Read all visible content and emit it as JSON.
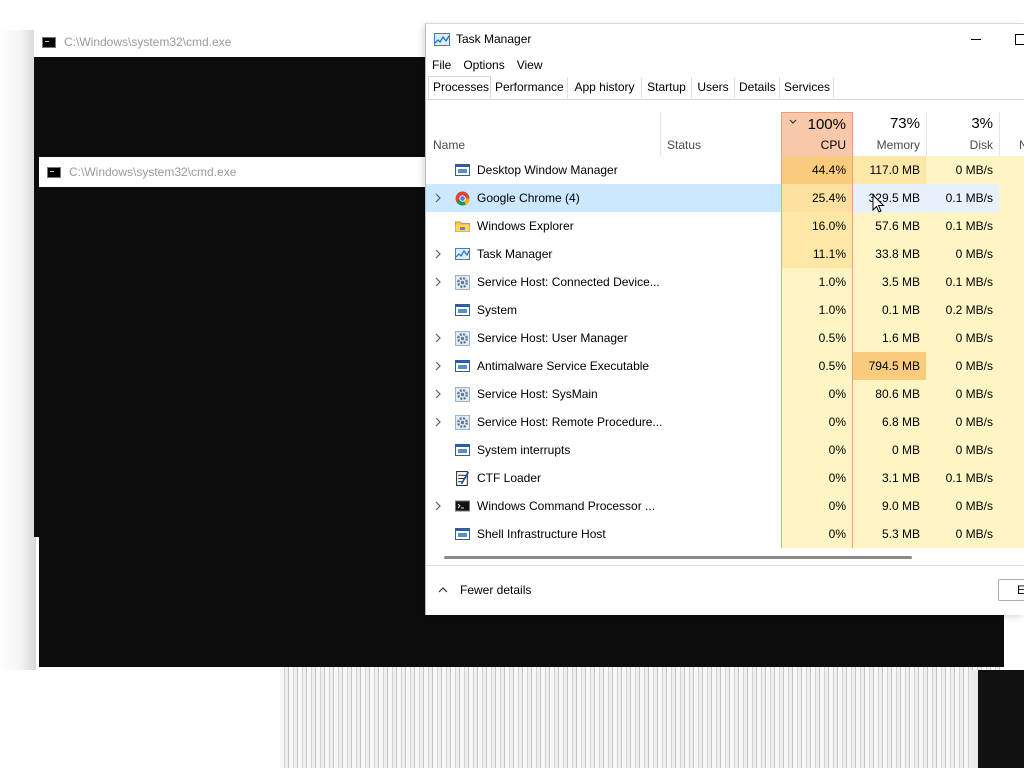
{
  "cmd_windows": [
    {
      "title": "C:\\Windows\\system32\\cmd.exe"
    },
    {
      "title": "C:\\Windows\\system32\\cmd.exe"
    }
  ],
  "task_manager": {
    "title": "Task Manager",
    "menu": [
      "File",
      "Options",
      "View"
    ],
    "tabs": [
      "Processes",
      "Performance",
      "App history",
      "Startup",
      "Users",
      "Details",
      "Services"
    ],
    "active_tab": "Processes",
    "columns": {
      "name": "Name",
      "status": "Status",
      "cpu": {
        "percent": "100%",
        "label": "CPU"
      },
      "memory": {
        "percent": "73%",
        "label": "Memory"
      },
      "disk": {
        "percent": "3%",
        "label": "Disk"
      },
      "network_truncated": "N"
    },
    "processes": [
      {
        "name": "Desktop Window Manager",
        "cpu": "44.4%",
        "memory": "117.0 MB",
        "disk": "0 MB/s",
        "expandable": false,
        "icon": "window-icon"
      },
      {
        "name": "Google Chrome (4)",
        "cpu": "25.4%",
        "memory": "329.5 MB",
        "disk": "0.1 MB/s",
        "expandable": true,
        "icon": "chrome-icon",
        "selected": true
      },
      {
        "name": "Windows Explorer",
        "cpu": "16.0%",
        "memory": "57.6 MB",
        "disk": "0.1 MB/s",
        "expandable": false,
        "icon": "folder-icon"
      },
      {
        "name": "Task Manager",
        "cpu": "11.1%",
        "memory": "33.8 MB",
        "disk": "0 MB/s",
        "expandable": true,
        "icon": "task-manager-icon"
      },
      {
        "name": "Service Host: Connected Device...",
        "cpu": "1.0%",
        "memory": "3.5 MB",
        "disk": "0.1 MB/s",
        "expandable": true,
        "icon": "gear-icon"
      },
      {
        "name": "System",
        "cpu": "1.0%",
        "memory": "0.1 MB",
        "disk": "0.2 MB/s",
        "expandable": false,
        "icon": "window-icon"
      },
      {
        "name": "Service Host: User Manager",
        "cpu": "0.5%",
        "memory": "1.6 MB",
        "disk": "0 MB/s",
        "expandable": true,
        "icon": "gear-icon"
      },
      {
        "name": "Antimalware Service Executable",
        "cpu": "0.5%",
        "memory": "794.5 MB",
        "disk": "0 MB/s",
        "expandable": true,
        "icon": "window-icon"
      },
      {
        "name": "Service Host: SysMain",
        "cpu": "0%",
        "memory": "80.6 MB",
        "disk": "0 MB/s",
        "expandable": true,
        "icon": "gear-icon"
      },
      {
        "name": "Service Host: Remote Procedure...",
        "cpu": "0%",
        "memory": "6.8 MB",
        "disk": "0 MB/s",
        "expandable": true,
        "icon": "gear-icon"
      },
      {
        "name": "System interrupts",
        "cpu": "0%",
        "memory": "0 MB",
        "disk": "0 MB/s",
        "expandable": false,
        "icon": "window-icon"
      },
      {
        "name": "CTF Loader",
        "cpu": "0%",
        "memory": "3.1 MB",
        "disk": "0.1 MB/s",
        "expandable": false,
        "icon": "notepad-icon"
      },
      {
        "name": "Windows Command Processor ...",
        "cpu": "0%",
        "memory": "9.0 MB",
        "disk": "0 MB/s",
        "expandable": true,
        "icon": "cmd-icon"
      },
      {
        "name": "Shell Infrastructure Host",
        "cpu": "0%",
        "memory": "5.3 MB",
        "disk": "0 MB/s",
        "expandable": false,
        "icon": "window-icon"
      }
    ],
    "footer": {
      "fewer_details": "Fewer details",
      "end_task_truncated": "E"
    }
  },
  "colors": {
    "cpu_header": "#f8c8ab",
    "heat_high": "#fbcb7d",
    "heat_mid": "#fde7a6",
    "heat_low": "#fff4c4",
    "selection": "#cce8ff"
  }
}
